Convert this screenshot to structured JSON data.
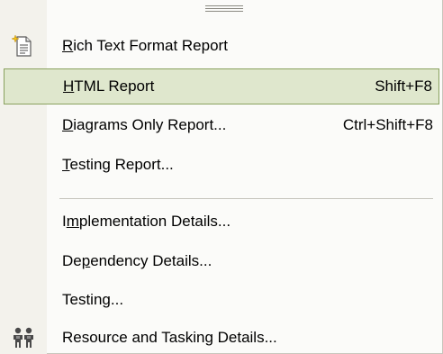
{
  "menu": {
    "items": [
      {
        "pre": "",
        "key": "R",
        "post": "ich Text Format Report",
        "shortcut": "",
        "icon": "document-report-icon",
        "highlighted": false
      },
      {
        "pre": "",
        "key": "H",
        "post": "TML Report",
        "shortcut": "Shift+F8",
        "icon": "",
        "highlighted": true
      },
      {
        "pre": "",
        "key": "D",
        "post": "iagrams Only Report...",
        "shortcut": "Ctrl+Shift+F8",
        "icon": "",
        "highlighted": false
      },
      {
        "pre": "",
        "key": "T",
        "post": "esting Report...",
        "shortcut": "",
        "icon": "",
        "highlighted": false
      },
      {
        "pre": "I",
        "key": "m",
        "post": "plementation Details...",
        "shortcut": "",
        "icon": "",
        "highlighted": false
      },
      {
        "pre": "De",
        "key": "p",
        "post": "endency Details...",
        "shortcut": "",
        "icon": "",
        "highlighted": false
      },
      {
        "pre": "Testin",
        "key": "g",
        "post": "...",
        "shortcut": "",
        "icon": "",
        "highlighted": false
      },
      {
        "pre": "Resource and Tasking Details...",
        "key": "",
        "post": "",
        "shortcut": "",
        "icon": "people-resource-icon",
        "highlighted": false
      }
    ]
  },
  "colors": {
    "highlight_fill": "#dfe7cd",
    "highlight_border": "#8aa25f",
    "gutter": "#f3f2ec",
    "separator": "#c5c4bc"
  }
}
